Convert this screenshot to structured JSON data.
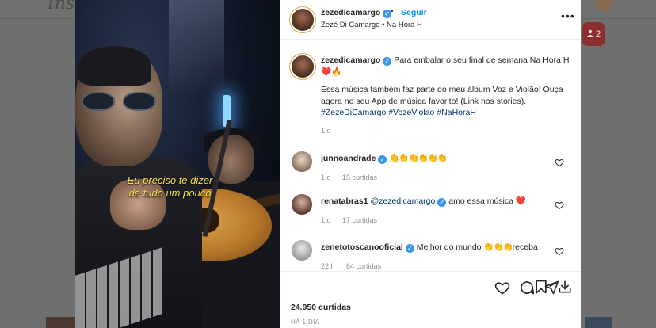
{
  "background": {
    "logo_text": "Inst",
    "notification_icon": "person-icon",
    "notification_count": "2"
  },
  "media": {
    "caption_line1": "Eu preciso te dizer",
    "caption_line2": "de tudo um pouco"
  },
  "post_header": {
    "username": "zezedicamargo",
    "separator": "•",
    "follow_label": "Seguir",
    "subtitle": "Zezé Di Camargo • Na Hora H",
    "more_icon": "more-horizontal-icon"
  },
  "caption": {
    "username": "zezedicamargo",
    "line1": "Para embalar o seu final de semana Na Hora H",
    "emoji": "❤️🔥",
    "line2": "Essa música também faz parte do meu álbum Voz e Violão! Ouça agora no seu App de música favorito! (Link nos stories).",
    "hashtags": "#ZezeDiCamargo #VozeViolao #NaHoraH",
    "time": "1 d"
  },
  "comments": [
    {
      "username": "junnoandrade",
      "text": "👏👏👏👏👏👏",
      "time": "1 d",
      "likes": "15 curtidas"
    },
    {
      "username": "renatabras1",
      "mention": "@zezedicamargo",
      "text": "amo essa música",
      "emoji": "❤️",
      "time": "1 d",
      "likes": "17 curtidas"
    },
    {
      "username": "zenetotoscanooficial",
      "text": "Melhor do mundo",
      "emoji": "👏👏👏",
      "suffix": "receba",
      "time": "22 h",
      "likes": "64 curtidas"
    }
  ],
  "actions": {
    "like_icon": "heart-icon",
    "comment_icon": "comment-icon",
    "share_icon": "send-icon",
    "save_icon": "bookmark-icon",
    "download_icon": "download-icon"
  },
  "stats": {
    "likes": "24.950 curtidas",
    "time_ago": "HÁ 1 DIA"
  },
  "colors": {
    "link_blue": "#0095f6",
    "verified_blue": "#3897f0",
    "hashtag_blue": "#00376b",
    "caption_yellow": "#f5e14a"
  }
}
